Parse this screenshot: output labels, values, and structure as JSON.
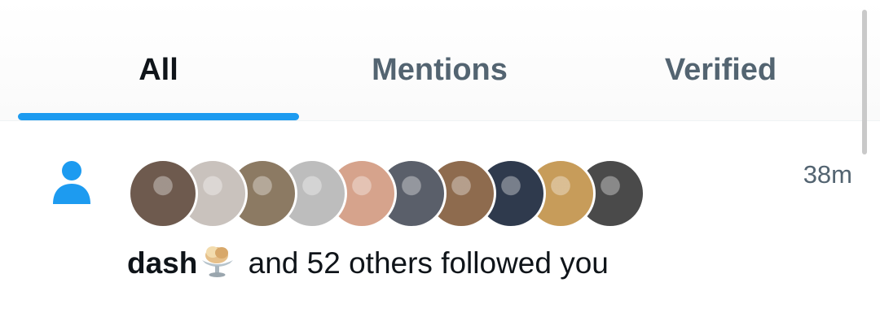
{
  "tabs": [
    {
      "label": "All",
      "active": true
    },
    {
      "label": "Mentions",
      "active": false
    },
    {
      "label": "Verified",
      "active": false
    }
  ],
  "accent_color": "#1d9bf0",
  "notification": {
    "type_icon": "person-icon",
    "avatars": [
      {
        "bg": "#6e5a4e"
      },
      {
        "bg": "#c9c2bd"
      },
      {
        "bg": "#8c7a63"
      },
      {
        "bg": "#bdbdbd"
      },
      {
        "bg": "#d6a38c"
      },
      {
        "bg": "#5a5f6a"
      },
      {
        "bg": "#8e6b4e"
      },
      {
        "bg": "#2f3a4d"
      },
      {
        "bg": "#c79c5a"
      },
      {
        "bg": "#4a4a4a"
      }
    ],
    "timestamp": "38m",
    "actor_name": "dash",
    "actor_emoji": "ice-cream-sundae-icon",
    "message_text": "and 52 others followed you"
  }
}
